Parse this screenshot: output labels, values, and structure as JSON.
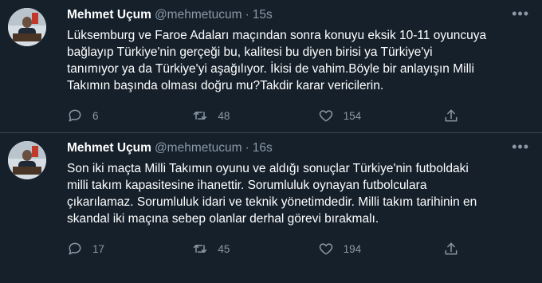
{
  "tweets": [
    {
      "name": "Mehmet Uçum",
      "handle": "@mehmetucum",
      "separator": "·",
      "time": "15s",
      "more_icon": "more-horizontal-icon",
      "text": "Lüksemburg ve Faroe Adaları maçından sonra konuyu eksik 10-11 oyuncuya\nbağlayıp Türkiye'nin gerçeği bu, kalitesi bu diyen birisi ya Türkiye'yi\ntanımıyor ya da Türkiye'yi aşağılıyor. İkisi de vahim.Böyle bir anlayışın Milli\nTakımın başında olması doğru mu?Takdir karar vericilerin.",
      "replies": "6",
      "retweets": "48",
      "likes": "154"
    },
    {
      "name": "Mehmet Uçum",
      "handle": "@mehmetucum",
      "separator": "·",
      "time": "16s",
      "more_icon": "more-horizontal-icon",
      "text": "Son iki maçta Milli Takımın oyunu ve aldığı sonuçlar Türkiye'nin futboldaki\nmilli takım kapasitesine ihanettir. Sorumluluk oynayan futbolculara\nçıkarılamaz. Sorumluluk idari ve teknik yönetimdedir. Milli takım tarihinin en\nskandal iki maçına sebep olanlar derhal görevi bırakmalı.",
      "replies": "17",
      "retweets": "45",
      "likes": "194"
    }
  ],
  "colors": {
    "background": "#15202b",
    "secondary_text": "#8b98a5",
    "divider": "#38444d"
  }
}
